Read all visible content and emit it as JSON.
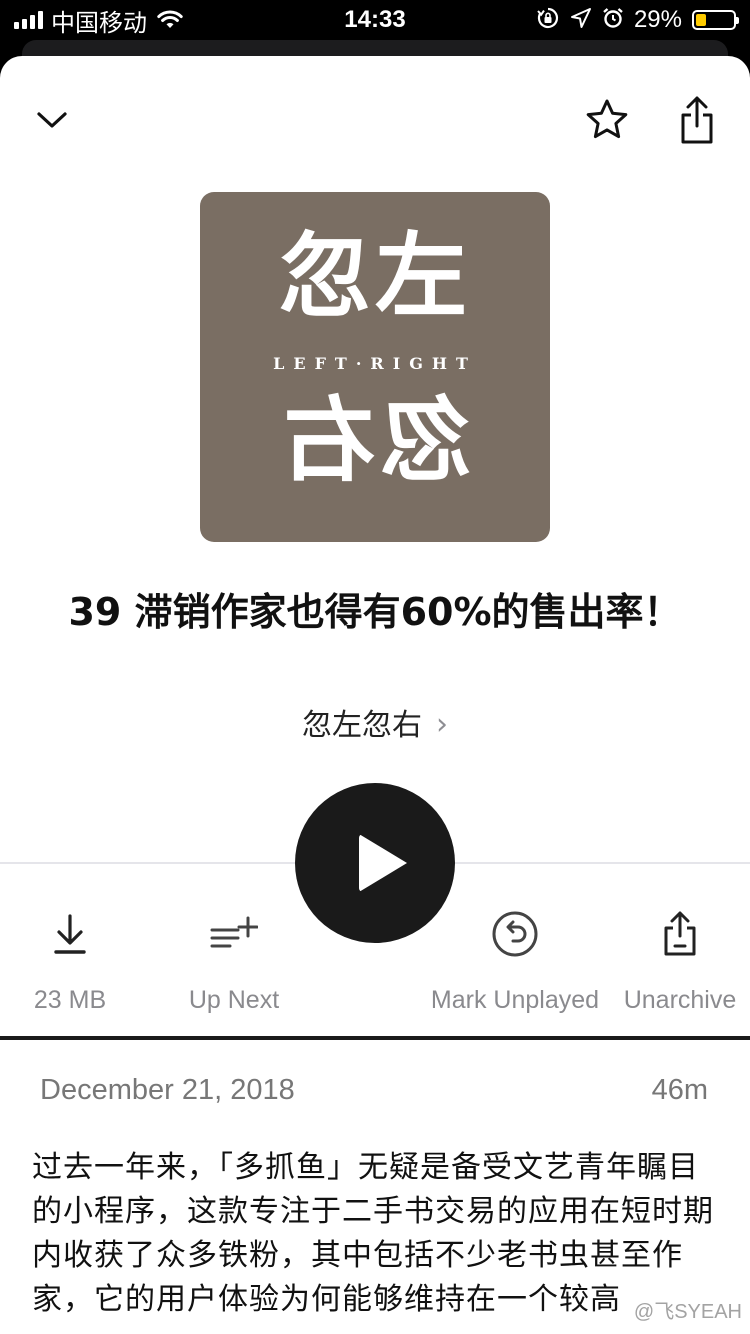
{
  "status_bar": {
    "carrier": "中国移动",
    "time": "14:33",
    "battery_percent": "29%",
    "battery_level": 0.29,
    "icons": [
      "signal-icon",
      "wifi-icon",
      "orientation-lock-icon",
      "location-icon",
      "alarm-icon",
      "battery-icon"
    ]
  },
  "header": {
    "collapse_icon": "chevron-down-icon",
    "favorite_icon": "star-icon",
    "share_icon": "share-icon"
  },
  "artwork": {
    "line1": "忽左",
    "subtitle": "LEFT·RIGHT",
    "line2": "忽右",
    "background_color": "#7a6e63"
  },
  "episode": {
    "title": "39 滞销作家也得有60%的售出率！",
    "podcast_name": "忽左忽右",
    "podcast_chevron": "›"
  },
  "actions": [
    {
      "icon": "download-icon",
      "label": "23 MB"
    },
    {
      "icon": "up-next-icon",
      "label": "Up Next"
    },
    {
      "icon": "mark-unplayed-icon",
      "label": "Mark Unplayed"
    },
    {
      "icon": "unarchive-icon",
      "label": "Unarchive"
    }
  ],
  "play_button": {
    "icon": "play-icon"
  },
  "details": {
    "date": "December 21, 2018",
    "duration": "46m",
    "description": "过去一年来，「多抓鱼」无疑是备受文艺青年瞩目的小程序，这款专注于二手书交易的应用在短时期内收获了众多铁粉，其中包括不少老书虫甚至作家，它的用户体验为何能够维持在一个较高"
  },
  "watermark": "@飞SYEAH"
}
